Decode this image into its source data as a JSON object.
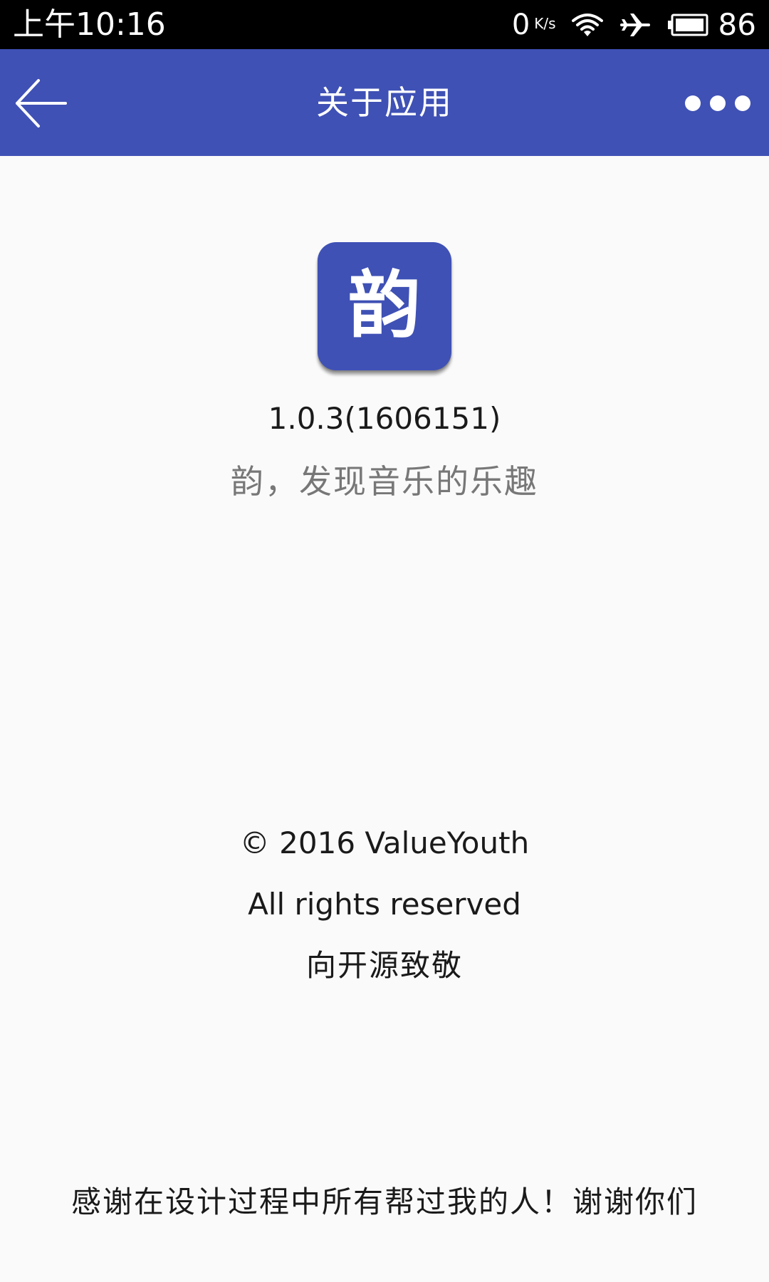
{
  "status_bar": {
    "time": "上午10:16",
    "net_speed_value": "0",
    "net_speed_unit": "K/s",
    "battery_level": "86"
  },
  "app_bar": {
    "title": "关于应用"
  },
  "app_info": {
    "icon_char": "韵",
    "version": "1.0.3(1606151)",
    "slogan": "韵，发现音乐的乐趣"
  },
  "footer": {
    "copyright": "© 2016 ValueYouth",
    "rights": "All rights reserved",
    "tribute": "向开源致敬",
    "thanks": "感谢在设计过程中所有帮过我的人！谢谢你们"
  },
  "colors": {
    "app_bar": "#3f51b5",
    "icon_bg": "#3f51b5",
    "background": "#fafafa",
    "status_bar": "#000000"
  },
  "icons": {
    "back": "arrow-left-icon",
    "more": "more-horizontal-icon",
    "wifi": "wifi-icon",
    "airplane": "airplane-mode-icon",
    "battery": "battery-icon"
  }
}
